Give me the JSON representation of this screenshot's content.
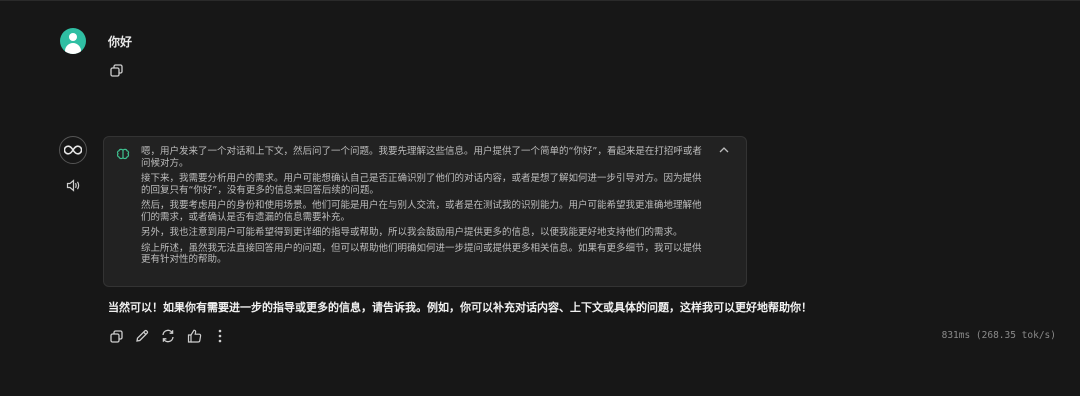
{
  "user_message": {
    "text": "你好"
  },
  "thinking": {
    "paragraphs": [
      "嗯，用户发来了一个对话和上下文，然后问了一个问题。我要先理解这些信息。用户提供了一个简单的“你好”，看起来是在打招呼或者问候对方。",
      "接下来，我需要分析用户的需求。用户可能想确认自己是否正确识别了他们的对话内容，或者是想了解如何进一步引导对方。因为提供的回复只有“你好”，没有更多的信息来回答后续的问题。",
      "然后，我要考虑用户的身份和使用场景。他们可能是用户在与别人交流，或者是在测试我的识别能力。用户可能希望我更准确地理解他们的需求，或者确认是否有遗漏的信息需要补充。",
      "另外，我也注意到用户可能希望得到更详细的指导或帮助，所以我会鼓励用户提供更多的信息，以便我能更好地支持他们的需求。",
      "综上所述，虽然我无法直接回答用户的问题，但可以帮助他们明确如何进一步提问或提供更多相关信息。如果有更多细节，我可以提供更有针对性的帮助。"
    ]
  },
  "answer": {
    "text": "当然可以！如果你有需要进一步的指导或更多的信息，请告诉我。例如，你可以补充对话内容、上下文或具体的问题，这样我可以更好地帮助你！"
  },
  "stats": {
    "text": "831ms (268.35 tok/s)"
  },
  "icons": {
    "user_avatar": "user-avatar-icon",
    "copy": "copy-icon",
    "model": "infinity-logo-icon",
    "speaker": "speaker-icon",
    "thinking": "brain-icon",
    "collapse": "chevron-up-icon",
    "edit": "pencil-icon",
    "regenerate": "refresh-icon",
    "like": "thumbs-up-icon",
    "more": "more-vertical-icon"
  },
  "colors": {
    "background": "#171717",
    "accent_avatar": "#2fbfa3",
    "thinking_icon": "#3fbf8f"
  }
}
